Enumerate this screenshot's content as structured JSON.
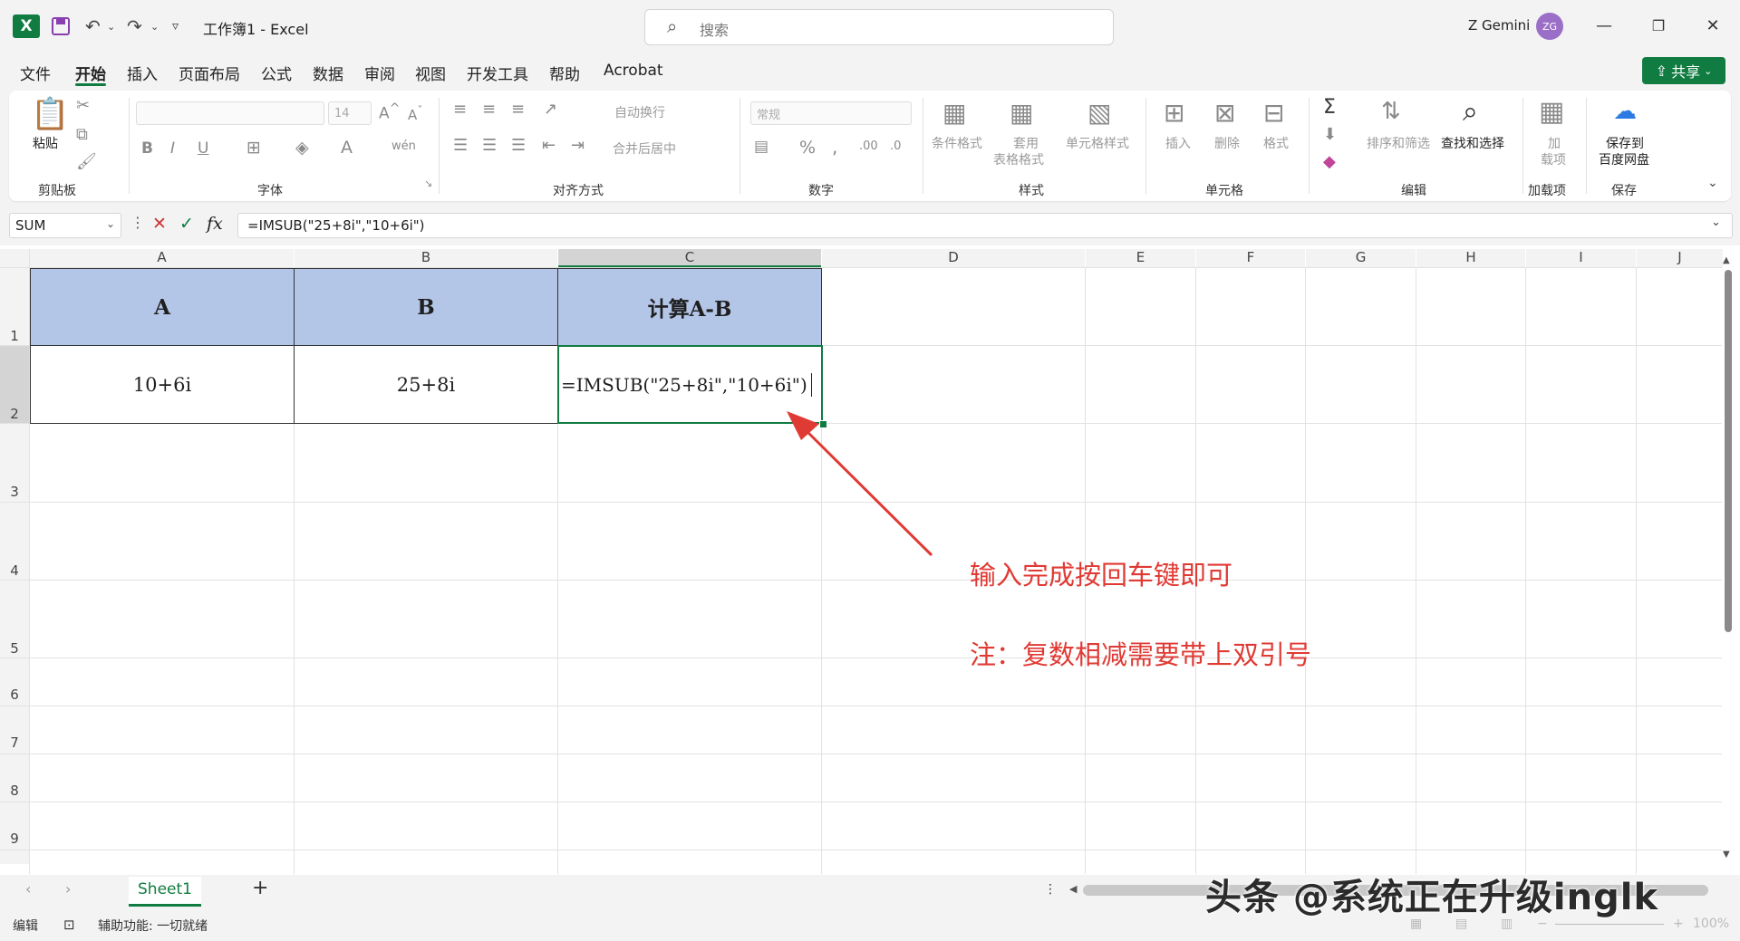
{
  "titlebar": {
    "doc_title": "工作簿1 - Excel",
    "search_placeholder": "搜索",
    "user_name": "Z Gemini",
    "avatar_initials": "ZG"
  },
  "menu": {
    "tabs": [
      "文件",
      "开始",
      "插入",
      "页面布局",
      "公式",
      "数据",
      "审阅",
      "视图",
      "开发工具",
      "帮助",
      "Acrobat"
    ],
    "active": "开始",
    "share_label": "共享"
  },
  "ribbon": {
    "clipboard": {
      "paste": "粘贴",
      "group": "剪贴板"
    },
    "font": {
      "size": "14",
      "group": "字体"
    },
    "alignment": {
      "wrap": "自动换行",
      "merge": "合并后居中",
      "group": "对齐方式"
    },
    "number": {
      "format": "常规",
      "group": "数字"
    },
    "styles": {
      "conditional": "条件格式",
      "table1": "套用",
      "table2": "表格格式",
      "cell_styles": "单元格样式",
      "group": "样式"
    },
    "cells": {
      "insert": "插入",
      "delete": "删除",
      "format": "格式",
      "group": "单元格"
    },
    "editing": {
      "sort": "排序和筛选",
      "find": "查找和选择",
      "group": "编辑"
    },
    "addins": {
      "label1": "加",
      "label2": "载项",
      "group": "加载项"
    },
    "save": {
      "label1": "保存到",
      "label2": "百度网盘",
      "group": "保存"
    }
  },
  "formula_bar": {
    "name_box": "SUM",
    "formula": "=IMSUB(\"25+8i\",\"10+6i\")"
  },
  "grid": {
    "columns": [
      "A",
      "B",
      "C",
      "D",
      "E",
      "F",
      "G",
      "H",
      "I",
      "J"
    ],
    "rows": [
      "1",
      "2",
      "3",
      "4",
      "5",
      "6",
      "7",
      "8",
      "9"
    ],
    "header_cells": [
      "A",
      "B",
      "计算A-B"
    ],
    "data_cells": [
      "10+6i",
      "25+8i",
      "=IMSUB(\"25+8i\",\"10+6i\")"
    ]
  },
  "annotations": {
    "line1": "输入完成按回车键即可",
    "line2": "注：复数相减需要带上双引号",
    "color": "#e03a34"
  },
  "sheets": {
    "tabs": [
      "Sheet1"
    ],
    "add": "+"
  },
  "statusbar": {
    "mode": "编辑",
    "accessibility": "辅助功能: 一切就绪",
    "zoom": "100%"
  },
  "watermark": "头条 @系统正在升级inglk",
  "colors": {
    "accent": "#107c41",
    "header_fill": "#b4c6e7"
  }
}
